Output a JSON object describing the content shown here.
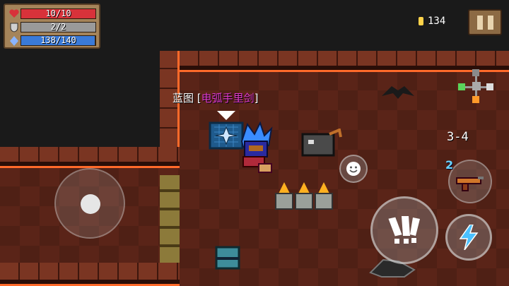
{
  "hud": {
    "health": {
      "value": "10/10",
      "fill": 1.0,
      "color": "#d8323a",
      "icon": "heart-icon"
    },
    "armor": {
      "value": "2/2",
      "fill": 1.0,
      "color": "#9a9a9a",
      "icon": "shield-icon"
    },
    "energy": {
      "value": "138/140",
      "fill": 0.986,
      "color": "#3a7ad8",
      "icon": "energy-crystal-icon"
    }
  },
  "coins": {
    "count": "134",
    "icon": "coin-icon"
  },
  "pause": {
    "icon": "pause-icon"
  },
  "item_label": {
    "prefix": "蓝图 [",
    "name": "电弧手里剑",
    "suffix": "]",
    "name_color": "#e03ad0"
  },
  "level": "3-4",
  "weapon": {
    "energy_cost": "2",
    "icon": "gun-icon"
  },
  "controls": {
    "joystick": "joystick-icon",
    "emote": "smiley-icon",
    "attack": "attack-icon",
    "skill": "lightning-icon"
  },
  "colors": {
    "floor": "#5a2418",
    "wall_trim": "#ff6a2a",
    "minimap_current": "#5ad45a"
  }
}
